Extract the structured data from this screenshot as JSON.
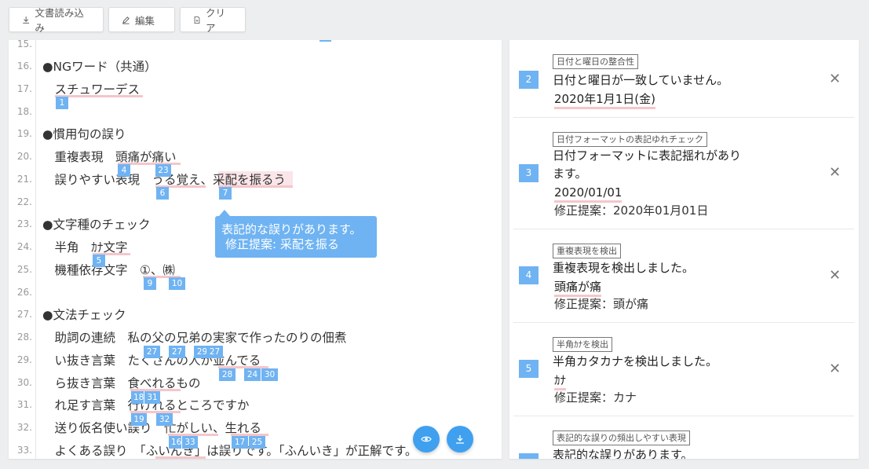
{
  "toolbar": {
    "import_label": "文書読み込み",
    "edit_label": "編集",
    "clear_label": "クリア"
  },
  "editor": {
    "lines": [
      {
        "n": "15.",
        "text": ""
      },
      {
        "n": "16.",
        "text": "●NGワード（共通）"
      },
      {
        "n": "17.",
        "text": "　スチュワーデス"
      },
      {
        "n": "18.",
        "text": ""
      },
      {
        "n": "19.",
        "text": "●慣用句の誤り"
      },
      {
        "n": "20.",
        "text": "　重複表現　頭痛が痛い"
      },
      {
        "n": "21.",
        "text": "　誤りやすい表現　うる覚え、采配を振るう"
      },
      {
        "n": "22.",
        "text": ""
      },
      {
        "n": "23.",
        "text": "●文字種のチェック"
      },
      {
        "n": "24.",
        "text": "　半角　ｶﾅ文字"
      },
      {
        "n": "25.",
        "text": "　機種依存文字　①、㈱"
      },
      {
        "n": "26.",
        "text": ""
      },
      {
        "n": "27.",
        "text": "●文法チェック"
      },
      {
        "n": "28.",
        "text": "　助詞の連続　私の父の兄弟の実家で作ったのりの佃煮"
      },
      {
        "n": "29.",
        "text": "　い抜き言葉　たくさんの人が並んでる"
      },
      {
        "n": "30.",
        "text": "　ら抜き言葉　食べれるもの"
      },
      {
        "n": "31.",
        "text": "　れ足す言葉　行けれるところですか"
      },
      {
        "n": "32.",
        "text": "　送り仮名使い誤り　忙がしい、生れる"
      },
      {
        "n": "33.",
        "text": "　よくある誤り　「ふいんき」は誤りです。「ふんいき」が正解です。"
      }
    ],
    "markers": [
      "1",
      "4",
      "23",
      "6",
      "7",
      "5",
      "9",
      "10",
      "27",
      "27",
      "29",
      "27",
      "28",
      "24",
      "30",
      "18",
      "31",
      "19",
      "32",
      "16",
      "33",
      "17",
      "25"
    ],
    "tooltip": {
      "line1": "表記的な誤りがあります。",
      "line2": "修正提案: 采配を振る"
    }
  },
  "results": [
    {
      "num": "2",
      "tag": "日付と曜日の整合性",
      "msg": [
        "日付と曜日が一致していません。"
      ],
      "hit": "2020年1月1日(金)",
      "suggestion": ""
    },
    {
      "num": "3",
      "tag": "日付フォーマットの表記ゆれチェック",
      "msg": [
        "日付フォーマットに表記揺れがあり",
        "ます。"
      ],
      "hit": "2020/01/01",
      "suggestion": "修正提案：2020年01月01日"
    },
    {
      "num": "4",
      "tag": "重複表現を検出",
      "msg": [
        "重複表現を検出しました。"
      ],
      "hit": "頭痛が痛",
      "suggestion": "修正提案：頭が痛"
    },
    {
      "num": "5",
      "tag": "半角ｶﾅを検出",
      "msg": [
        "半角カタカナを検出しました。"
      ],
      "hit": "ｶﾅ",
      "suggestion": "修正提案：カナ"
    },
    {
      "num": "",
      "tag": "表記的な誤りの頻出しやすい表現",
      "msg": [
        "表記的な誤りがあります。"
      ],
      "hit": "",
      "suggestion": ""
    }
  ]
}
